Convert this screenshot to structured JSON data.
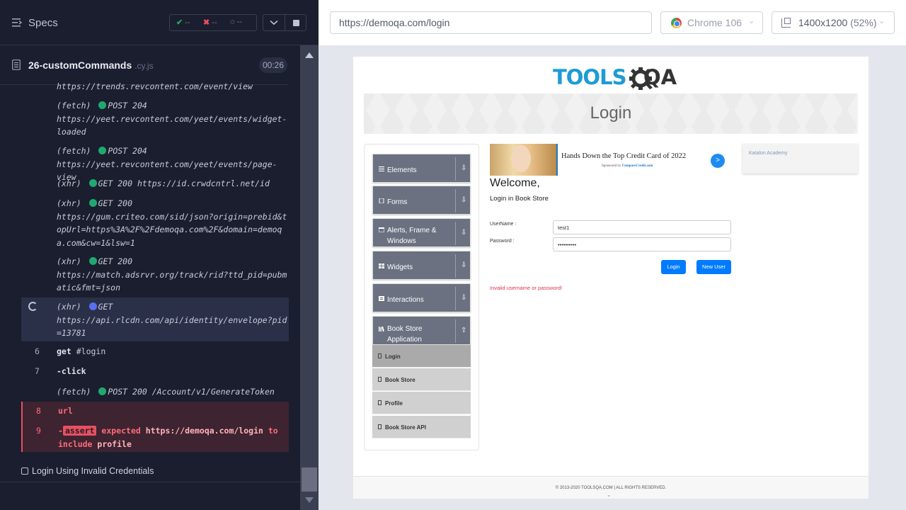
{
  "reporter": {
    "specs_label": "Specs",
    "stats": {
      "passed": "--",
      "failed": "--",
      "pending": "--"
    },
    "colors": {
      "pass": "#1fa971",
      "fail": "#e94f5f",
      "pending_dot": "#5a6ef2"
    },
    "spec": {
      "name": "26-customCommands",
      "ext": ".cy.js",
      "duration": "00:26"
    },
    "log": [
      {
        "text": "https://trends.revcontent.com/event/view"
      },
      {
        "kind": "(fetch)",
        "method": "POST 204",
        "url": "https://yeet.revcontent.com/yeet/events/widget-loaded"
      },
      {
        "kind": "(fetch)",
        "method": "POST 204",
        "url": "https://yeet.revcontent.com/yeet/events/page-view"
      },
      {
        "kind": "(xhr)",
        "method": "GET 200",
        "url": "https://id.crwdcntrl.net/id"
      },
      {
        "kind": "(xhr)",
        "method": "GET 200",
        "url": "https://gum.criteo.com/sid/json?origin=prebid&topUrl=https%3A%2F%2Fdemoqa.com%2F&domain=demoqa.com&cw=1&lsw=1"
      },
      {
        "kind": "(xhr)",
        "method": "GET 200",
        "url": "https://match.adsrvr.org/track/rid?ttd_pid=pubmatic&fmt=json"
      },
      {
        "kind": "(xhr)",
        "method": "GET",
        "url": "https://api.rlcdn.com/api/identity/envelope?pid=13781"
      },
      {
        "num": "6",
        "cmd": "get",
        "arg": "#login"
      },
      {
        "num": "7",
        "cmd": "-click"
      },
      {
        "kind": "(fetch)",
        "method": "POST 200",
        "url": "/Account/v1/GenerateToken"
      },
      {
        "num": "8",
        "cmd": "url"
      },
      {
        "num": "9",
        "prefix": "-",
        "badge": "assert",
        "msg": "expected",
        "value": "https://demoqa.com/login",
        "to": "to",
        "include": "include",
        "expected": "profile"
      }
    ],
    "test_title": "Login Using Invalid Credentials"
  },
  "aut": {
    "url": "https://demoqa.com/login",
    "browser": "Chrome 106",
    "viewport": "1400x1200",
    "zoom": "(52%)",
    "page": {
      "logo_tools": "TOOLS",
      "logo_qa": "QA",
      "banner_title": "Login",
      "menu": [
        {
          "label": "Elements",
          "arrow": "⇩"
        },
        {
          "label": "Forms",
          "arrow": "⇩"
        },
        {
          "label": "Alerts, Frame & Windows",
          "arrow": "⇩"
        },
        {
          "label": "Widgets",
          "arrow": "⇩"
        },
        {
          "label": "Interactions",
          "arrow": "⇩"
        },
        {
          "label": "Book Store Application",
          "arrow": "⇧"
        }
      ],
      "submenu": [
        "Login",
        "Book Store",
        "Profile",
        "Book Store API"
      ],
      "ad": {
        "title": "Hands Down the Top Credit Card of 2022",
        "sponsor": "Sponsored by",
        "sponsor_brand": "CompareCredit.com",
        "button": ">"
      },
      "ad2_label": "Katalon Academy",
      "welcome": "Welcome,",
      "subtitle": "Login in Book Store",
      "username_label": "UserName :",
      "password_label": "Password :",
      "username_value": "test1",
      "password_value": "••••••••••",
      "login_button": "Login",
      "new_user_button": "New User",
      "error": "Invalid username or password!",
      "footer": "© 2013-2020 TOOLSQA.COM | ALL RIGHTS RESERVED."
    }
  }
}
